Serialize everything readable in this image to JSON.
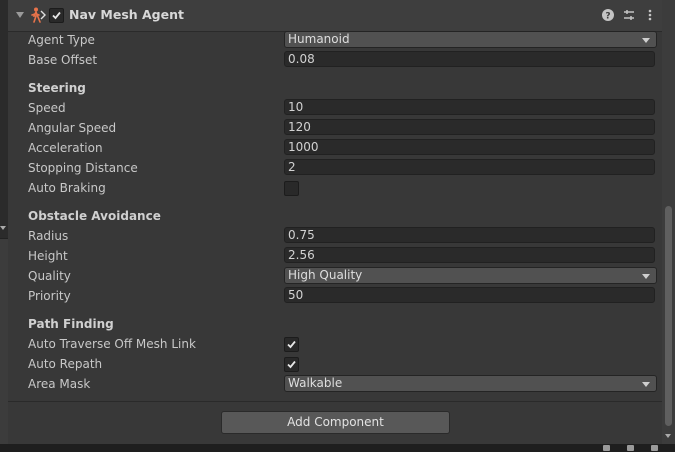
{
  "component": {
    "title": "Nav Mesh Agent",
    "enabled": true,
    "fold_icon": "chevron-down-icon",
    "component_icon": "nav-mesh-agent-icon",
    "header_icons": [
      "help-icon",
      "presets-icon",
      "context-menu-icon"
    ]
  },
  "agent_type": {
    "label": "Agent Type",
    "value": "Humanoid"
  },
  "base_offset": {
    "label": "Base Offset",
    "value": "0.08"
  },
  "steering": {
    "title": "Steering",
    "speed": {
      "label": "Speed",
      "value": "10"
    },
    "angular_speed": {
      "label": "Angular Speed",
      "value": "120"
    },
    "acceleration": {
      "label": "Acceleration",
      "value": "1000"
    },
    "stopping_distance": {
      "label": "Stopping Distance",
      "value": "2"
    },
    "auto_braking": {
      "label": "Auto Braking",
      "checked": false
    }
  },
  "obstacle_avoidance": {
    "title": "Obstacle Avoidance",
    "radius": {
      "label": "Radius",
      "value": "0.75"
    },
    "height": {
      "label": "Height",
      "value": "2.56"
    },
    "quality": {
      "label": "Quality",
      "value": "High Quality"
    },
    "priority": {
      "label": "Priority",
      "value": "50"
    }
  },
  "path_finding": {
    "title": "Path Finding",
    "auto_traverse": {
      "label": "Auto Traverse Off Mesh Link",
      "checked": true
    },
    "auto_repath": {
      "label": "Auto Repath",
      "checked": true
    },
    "area_mask": {
      "label": "Area Mask",
      "value": "Walkable"
    }
  },
  "add_component_label": "Add Component",
  "colors": {
    "background": "#383838",
    "field": "#2a2a2a",
    "dropdown": "#515151",
    "button": "#585858",
    "icon_accent": "#e8734a"
  }
}
